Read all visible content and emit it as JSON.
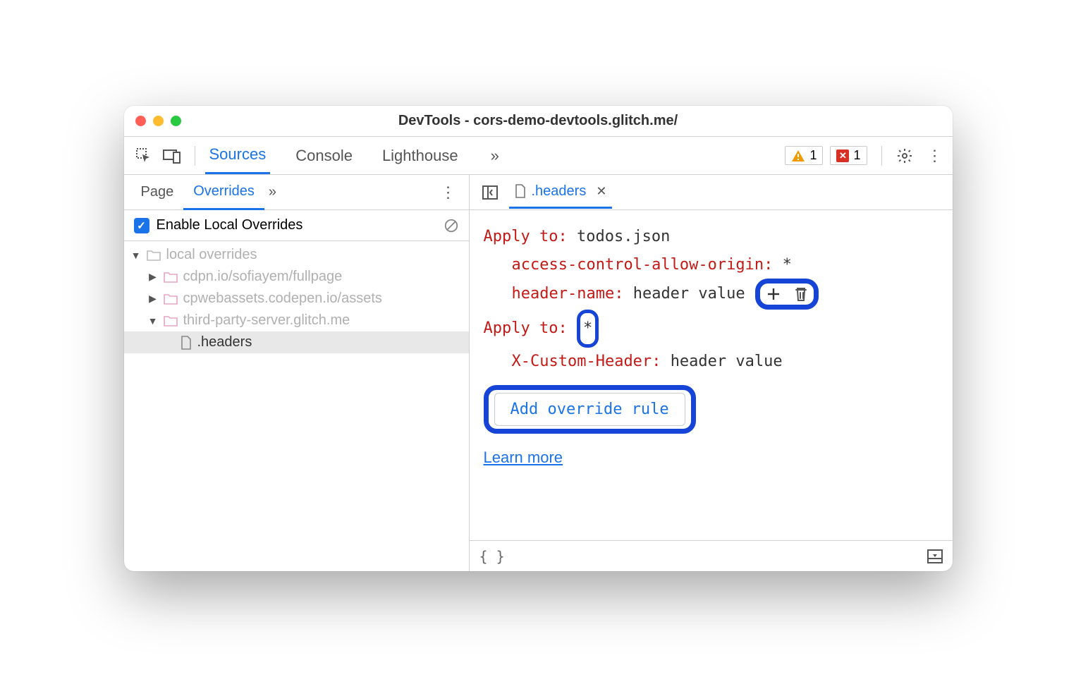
{
  "window": {
    "title": "DevTools - cors-demo-devtools.glitch.me/"
  },
  "main_tabs": {
    "sources": "Sources",
    "console": "Console",
    "lighthouse": "Lighthouse"
  },
  "badges": {
    "warnings": "1",
    "errors": "1"
  },
  "left_tabs": {
    "page": "Page",
    "overrides": "Overrides"
  },
  "enable_overrides_label": "Enable Local Overrides",
  "tree": {
    "root": "local overrides",
    "n0": "cdpn.io/sofiayem/fullpage",
    "n1": "cpwebassets.codepen.io/assets",
    "n2": "third-party-server.glitch.me",
    "file": ".headers"
  },
  "file_tab": ".headers",
  "editor": {
    "apply_label": "Apply to",
    "rule0_target": "todos.json",
    "rule0_h0_name": "access-control-allow-origin",
    "rule0_h0_value": "*",
    "rule0_h1_name": "header-name",
    "rule0_h1_value": "header value",
    "rule1_target": "*",
    "rule1_h0_name": "X-Custom-Header",
    "rule1_h0_value": "header value",
    "add_rule_button": "Add override rule",
    "learn_more": "Learn more"
  }
}
